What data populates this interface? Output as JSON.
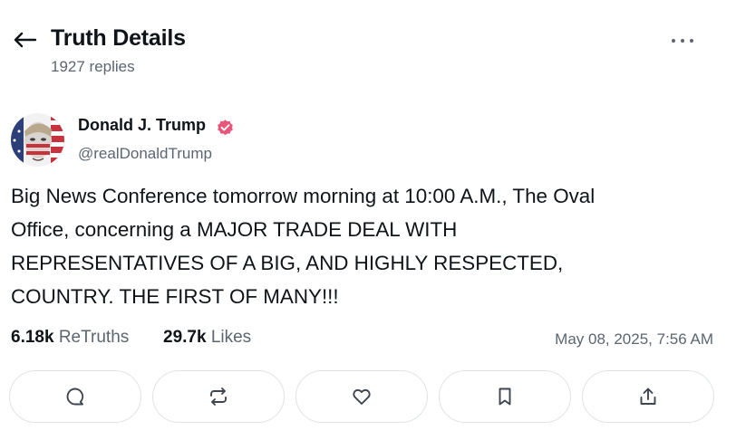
{
  "header": {
    "title": "Truth Details",
    "replies": "1927 replies",
    "back_icon": "arrow-left-icon",
    "more_icon": "ellipsis-icon"
  },
  "author": {
    "name": "Donald J. Trump",
    "handle": "@realDonaldTrump",
    "verified": true,
    "verified_color": "#e8567a"
  },
  "post": {
    "text": "Big News Conference tomorrow morning at 10:00 A.M., The Oval\nOffice, concerning a MAJOR TRADE DEAL WITH\nREPRESENTATIVES OF A BIG, AND HIGHLY RESPECTED,\nCOUNTRY. THE FIRST OF MANY!!!",
    "retruths_count": "6.18k",
    "retruths_label": "ReTruths",
    "likes_count": "29.7k",
    "likes_label": "Likes",
    "timestamp": "May 08, 2025, 7:56 AM"
  },
  "actions": [
    {
      "icon": "reply-icon"
    },
    {
      "icon": "retruth-icon"
    },
    {
      "icon": "heart-icon"
    },
    {
      "icon": "bookmark-icon"
    },
    {
      "icon": "share-icon"
    }
  ],
  "colors": {
    "text": "#0f1419",
    "muted": "#5b6672",
    "border": "#dfe3e8"
  }
}
